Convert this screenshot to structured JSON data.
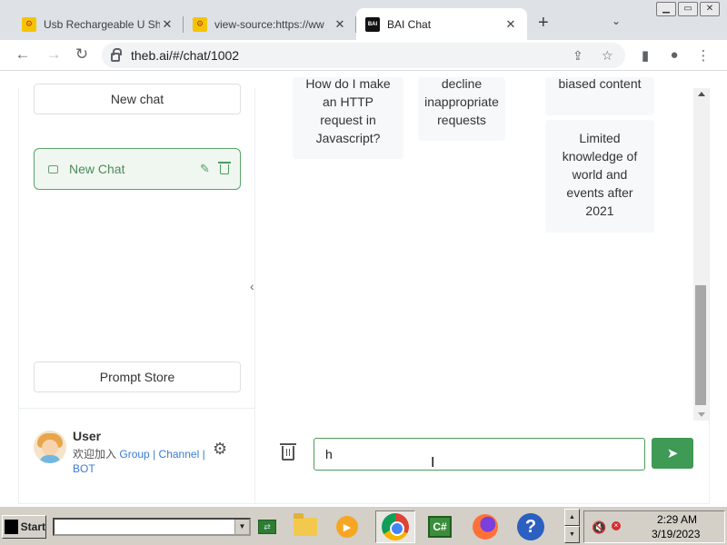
{
  "browser": {
    "tabs": [
      {
        "title": "Usb Rechargeable U Sh",
        "favicon": "gear-favicon"
      },
      {
        "title": "view-source:https://ww",
        "favicon": "gear-favicon"
      },
      {
        "title": "BAI Chat",
        "favicon": "bai-favicon",
        "favicon_text": "BAI",
        "active": true
      }
    ],
    "url": "theb.ai/#/chat/1002",
    "window_controls": [
      "minimize",
      "restore",
      "close"
    ]
  },
  "sidebar": {
    "new_chat_label": "New chat",
    "chats": [
      {
        "label": "New Chat",
        "selected": true
      }
    ],
    "prompt_store_label": "Prompt Store",
    "user": {
      "name": "User",
      "join_text": "欢迎加入",
      "links": [
        "Group",
        "Channel",
        "BOT"
      ],
      "separator": "|"
    }
  },
  "main": {
    "cards": [
      {
        "text": "How do I make an HTTP request in Javascript?",
        "visible_lines": [
          "How do I make",
          "an HTTP",
          "request in",
          "Javascript?"
        ]
      },
      {
        "text": "decline inappropriate requests",
        "visible_lines": [
          "decline",
          "inappropriate",
          "requests"
        ]
      },
      {
        "text": "biased content",
        "visible_lines": [
          "biased content"
        ]
      },
      {
        "text": "Limited knowledge of world and events after 2021",
        "visible_lines": [
          "Limited",
          "knowledge of",
          "world and",
          "events after",
          "2021"
        ]
      }
    ],
    "input": {
      "value": "h"
    },
    "send_icon": "send-icon",
    "clear_icon": "trash-icon",
    "accent_color": "#3f9a55"
  },
  "taskbar": {
    "start_label": "Start",
    "quick_launch": [
      "network-icon",
      "folder-icon",
      "media-player-icon",
      "chrome-icon",
      "csharp-icon",
      "firefox-icon",
      "help-icon"
    ],
    "csharp_label": "C#",
    "help_label": "?",
    "clock": {
      "time": "2:29 AM",
      "date": "3/19/2023"
    }
  }
}
